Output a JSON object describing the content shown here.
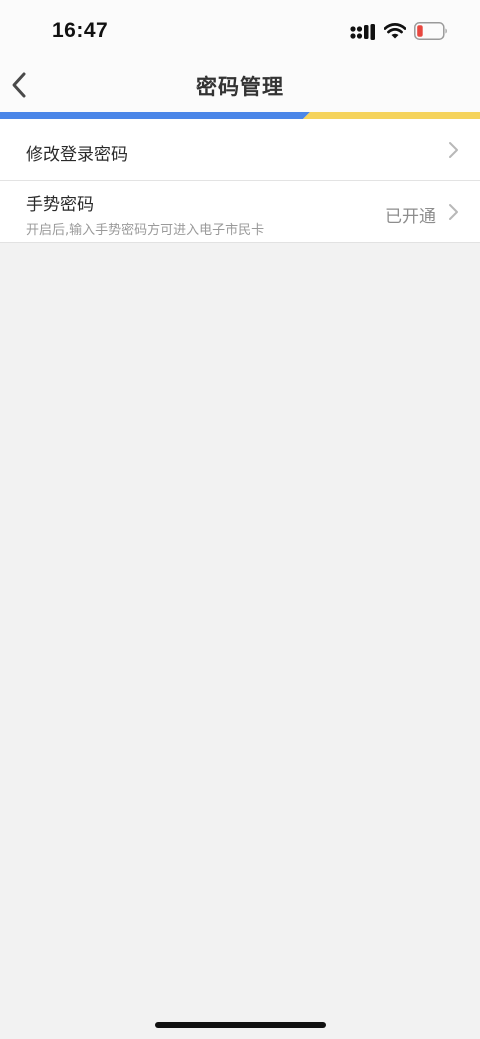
{
  "status_bar": {
    "time": "16:47",
    "icons": [
      "signal-icon",
      "wifi-icon",
      "battery-icon"
    ],
    "battery_color": "#e8473f"
  },
  "nav": {
    "back_icon": "back-chevron-icon",
    "title": "密码管理"
  },
  "accent_colors": {
    "stripe_left": "#4a86e8",
    "stripe_right": "#f5d35c"
  },
  "settings": {
    "items": [
      {
        "label": "修改登录密码",
        "chevron_icon": "chevron-right-icon"
      },
      {
        "label": "手势密码",
        "subtitle": "开启后,输入手势密码方可进入电子市民卡",
        "value": "已开通",
        "chevron_icon": "chevron-right-icon"
      }
    ]
  }
}
